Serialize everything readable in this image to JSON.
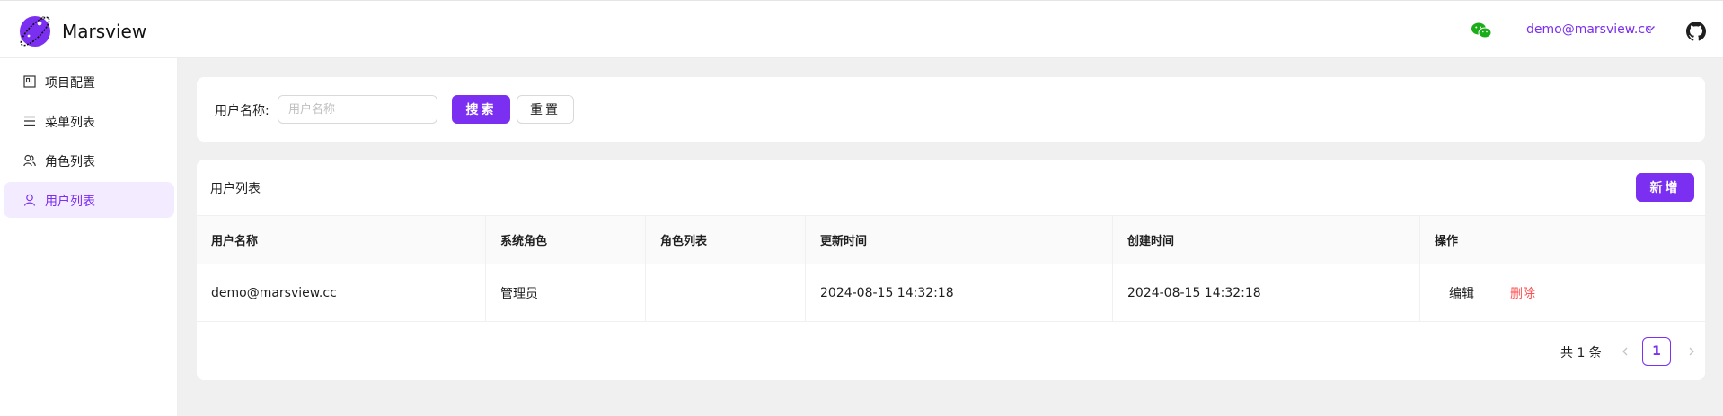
{
  "header": {
    "app_title": "Marsview",
    "user_email": "demo@marsview.cc",
    "icons": {
      "logo": "planet-logo-icon",
      "wechat": "wechat-icon",
      "github": "github-icon",
      "dropdown": "chevron-down-icon"
    }
  },
  "sidebar": {
    "items": [
      {
        "label": "项目配置",
        "icon": "layout-icon",
        "active": false
      },
      {
        "label": "菜单列表",
        "icon": "menu-lines-icon",
        "active": false
      },
      {
        "label": "角色列表",
        "icon": "roles-icon",
        "active": false
      },
      {
        "label": "用户列表",
        "icon": "user-icon",
        "active": true
      }
    ]
  },
  "search": {
    "label": "用户名称:",
    "placeholder": "用户名称",
    "value": "",
    "search_button": "搜索",
    "reset_button": "重置"
  },
  "list": {
    "title": "用户列表",
    "add_button": "新增",
    "columns": [
      "用户名称",
      "系统角色",
      "角色列表",
      "更新时间",
      "创建时间",
      "操作"
    ],
    "rows": [
      {
        "username": "demo@marsview.cc",
        "system_role": "管理员",
        "role_list": "",
        "updated_at": "2024-08-15 14:32:18",
        "created_at": "2024-08-15 14:32:18",
        "edit": "编辑",
        "delete": "删除"
      }
    ],
    "pagination": {
      "total_text": "共 1 条",
      "current_page": "1"
    }
  },
  "colors": {
    "accent": "#7b2ff0",
    "danger": "#ff4d4f",
    "active_bg": "#f3ebff"
  }
}
